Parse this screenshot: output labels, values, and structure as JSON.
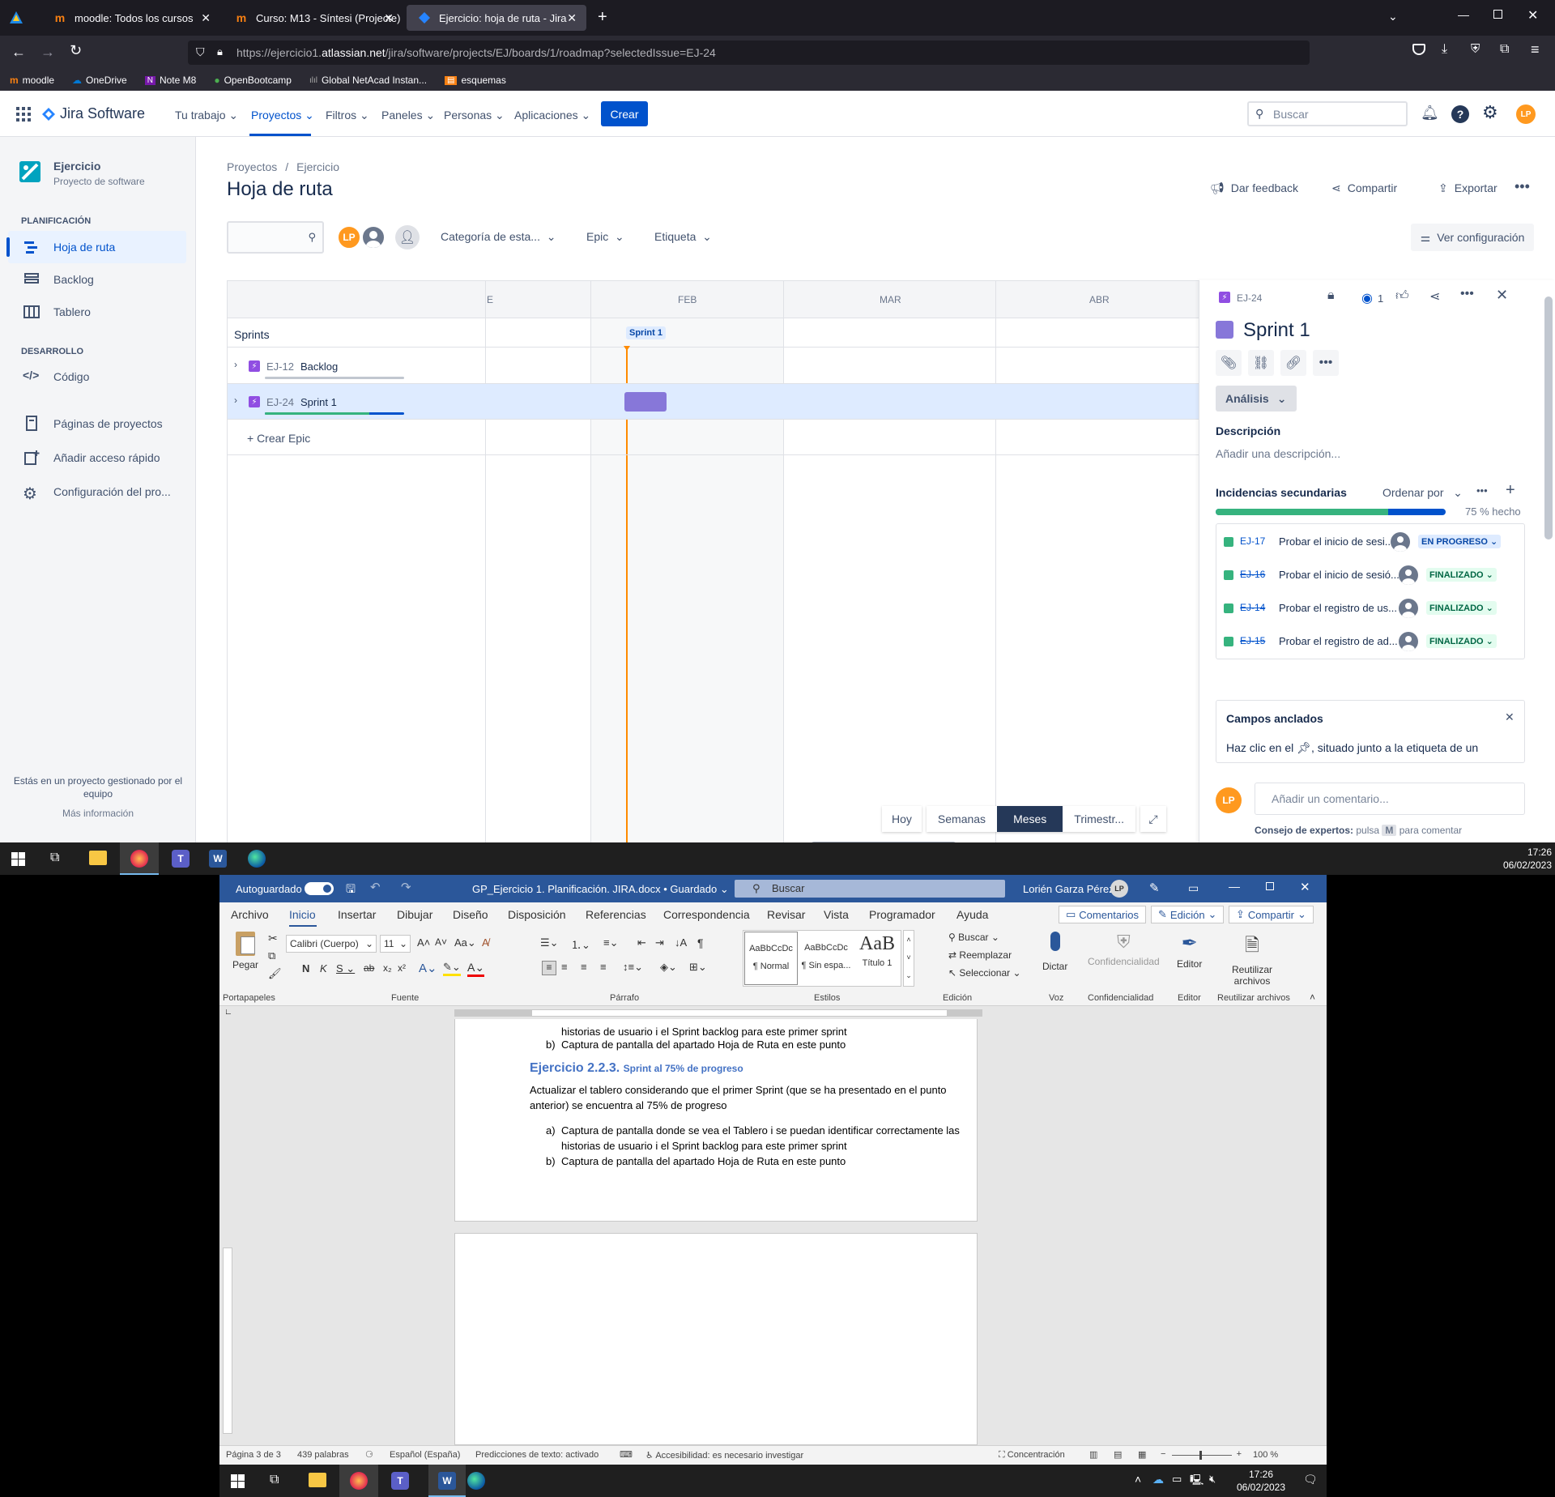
{
  "browser": {
    "tabs": [
      {
        "label": "moodle: Todos los cursos",
        "favicon": "moodle-icon"
      },
      {
        "label": "Curso: M13 - Síntesi (Projecte)",
        "favicon": "moodle-icon"
      },
      {
        "label": "Ejercicio: hoja de ruta - Jira",
        "favicon": "jira-icon",
        "active": true
      }
    ],
    "url_prefix": "https://ejercicio1.",
    "url_domain": "atlassian.net",
    "url_path": "/jira/software/projects/EJ/boards/1/roadmap?selectedIssue=EJ-24",
    "bookmarks": [
      "moodle",
      "OneDrive",
      "Note M8",
      "OpenBootcamp",
      "Global NetAcad Instan...",
      "esquemas"
    ]
  },
  "jira": {
    "logo": "Jira Software",
    "nav": [
      "Tu trabajo",
      "Proyectos",
      "Filtros",
      "Paneles",
      "Personas",
      "Aplicaciones"
    ],
    "create": "Crear",
    "search_placeholder": "Buscar",
    "avatar": "LP",
    "project": {
      "name": "Ejercicio",
      "type": "Proyecto de software"
    },
    "sections": {
      "planning": "PLANIFICACIÓN",
      "dev": "DESARROLLO"
    },
    "sidebar": {
      "roadmap": "Hoja de ruta",
      "backlog": "Backlog",
      "board": "Tablero",
      "code": "Código",
      "pages": "Páginas de proyectos",
      "shortcut": "Añadir acceso rápido",
      "settings": "Configuración del pro..."
    },
    "team_note": "Estás en un proyecto gestionado por el equipo",
    "more_info": "Más información",
    "breadcrumb": [
      "Proyectos",
      "/",
      "Ejercicio"
    ],
    "title": "Hoja de ruta",
    "actions": {
      "feedback": "Dar feedback",
      "share": "Compartir",
      "export": "Exportar",
      "view_config": "Ver configuración"
    },
    "filters": {
      "status_cat": "Categoría de esta...",
      "epic": "Epic",
      "label": "Etiqueta"
    },
    "timeline": {
      "months": [
        "E",
        "FEB",
        "MAR",
        "ABR"
      ],
      "sprints_label": "Sprints",
      "sprint_chip": "Sprint 1",
      "rows": [
        {
          "key": "EJ-12",
          "name": "Backlog"
        },
        {
          "key": "EJ-24",
          "name": "Sprint 1"
        }
      ],
      "create_epic": "+ Crear Epic",
      "views": [
        "Hoy",
        "Semanas",
        "Meses",
        "Trimestr..."
      ],
      "active_view": "Meses"
    },
    "panel": {
      "key": "EJ-24",
      "watchers": "1",
      "title": "Sprint 1",
      "status": "Análisis",
      "desc_label": "Descripción",
      "desc_placeholder": "Añadir una descripción...",
      "child_label": "Incidencias secundarias",
      "order_by": "Ordenar por",
      "progress_text": "75 % hecho",
      "progress": 0.75,
      "children": [
        {
          "key": "EJ-17",
          "title": "Probar el inicio de sesi...",
          "status": "EN PROGRESO",
          "done": false
        },
        {
          "key": "EJ-16",
          "title": "Probar el inicio de sesió...",
          "status": "FINALIZADO",
          "done": true
        },
        {
          "key": "EJ-14",
          "title": "Probar el registro de us...",
          "status": "FINALIZADO",
          "done": true
        },
        {
          "key": "EJ-15",
          "title": "Probar el registro de ad...",
          "status": "FINALIZADO",
          "done": true
        }
      ],
      "pinned_title": "Campos anclados",
      "pinned_text": "Haz clic en el",
      "pinned_text2": ", situado junto a la etiqueta de un",
      "comment_placeholder": "Añadir un comentario...",
      "tip_bold": "Consejo de expertos:",
      "tip_pre": "pulsa",
      "tip_key": "M",
      "tip_post": "para comentar"
    }
  },
  "taskbar_top": {
    "time": "17:26",
    "date": "06/02/2023"
  },
  "word": {
    "autosave": "Autoguardado",
    "doc_title": "GP_Ejercicio 1. Planificación. JIRA.docx • Guardado",
    "search": "Buscar",
    "user": "Lorién Garza Pérez",
    "user_initials": "LP",
    "menu": [
      "Archivo",
      "Inicio",
      "Insertar",
      "Dibujar",
      "Diseño",
      "Disposición",
      "Referencias",
      "Correspondencia",
      "Revisar",
      "Vista",
      "Programador",
      "Ayuda"
    ],
    "menu_right": [
      "Comentarios",
      "Edición",
      "Compartir"
    ],
    "font": "Calibri (Cuerpo)",
    "size": "11",
    "styles": [
      {
        "preview": "AaBbCcDc",
        "name": "¶ Normal"
      },
      {
        "preview": "AaBbCcDc",
        "name": "¶ Sin espa..."
      },
      {
        "preview": "AaB",
        "name": "Título 1"
      }
    ],
    "editing": [
      "Buscar",
      "Reemplazar",
      "Seleccionar"
    ],
    "buttons": {
      "paste": "Pegar",
      "dictate": "Dictar",
      "conf": "Confidencialidad",
      "editor": "Editor",
      "reuse": "Reutilizar archivos"
    },
    "groups": [
      "Portapapeles",
      "Fuente",
      "Párrafo",
      "Estilos",
      "Edición",
      "Voz",
      "Confidencialidad",
      "Editor",
      "Reutilizar archivos"
    ],
    "doc": {
      "l1": "historias de usuario i el Sprint backlog para este primer sprint",
      "l2_letter": "b)",
      "l2": "Captura de pantalla del apartado Hoja de Ruta en este punto",
      "heading_num": "Ejercicio 2.2.3.",
      "heading_sub": "Sprint al 75% de progreso",
      "para1": "Actualizar el tablero considerando que el primer Sprint (que se ha presentado en el punto",
      "para2": "anterior) se encuentra al 75% de progreso",
      "a_letter": "a)",
      "a1": "Captura de pantalla donde se vea el Tablero i se puedan identificar correctamente las",
      "a2": "historias de usuario i el Sprint backlog para este primer sprint",
      "b_letter": "b)",
      "b1": "Captura de pantalla del apartado Hoja de Ruta en este punto"
    },
    "status": {
      "page": "Página 3 de 3",
      "words": "439 palabras",
      "lang": "Español (España)",
      "pred": "Predicciones de texto: activado",
      "access": "Accesibilidad: es necesario investigar",
      "focus": "Concentración",
      "zoom": "100 %"
    }
  },
  "taskbar_bottom": {
    "time": "17:26",
    "date": "06/02/2023"
  }
}
